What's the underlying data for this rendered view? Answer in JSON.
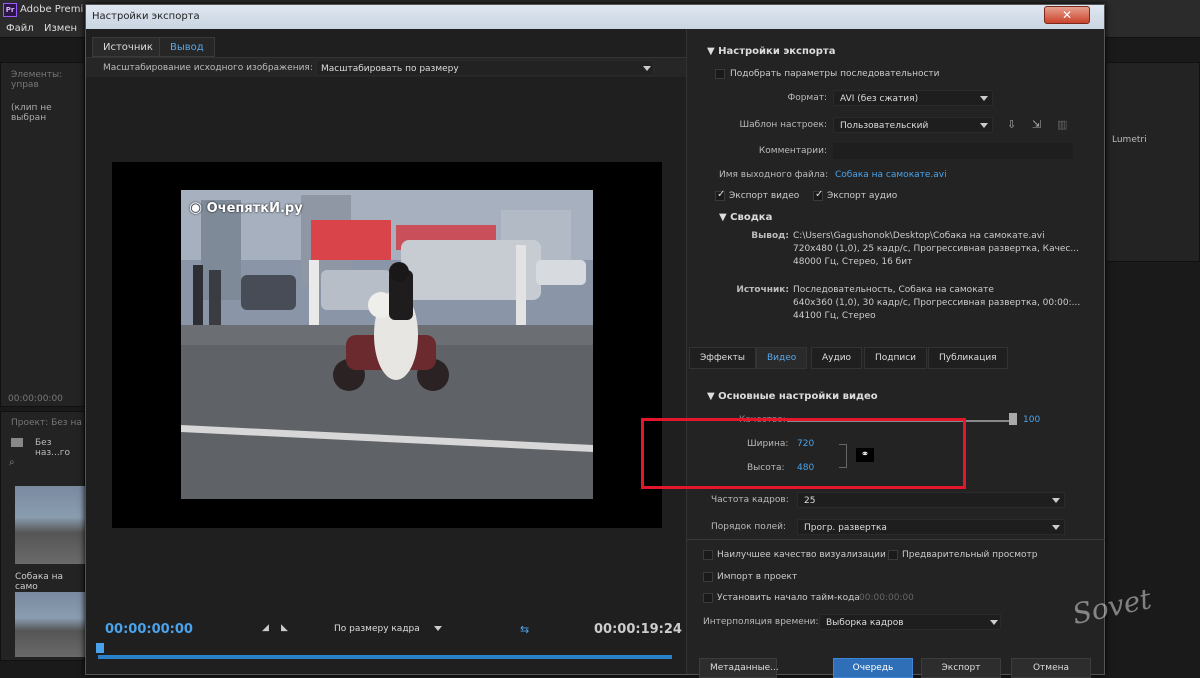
{
  "app": {
    "title": "Adobe Premi",
    "menu": [
      "Файл",
      "Измен"
    ]
  },
  "bg": {
    "panel_label_1": "Элементы: управ",
    "no_clip": "(клип не выбран",
    "timecode": "00:00:00:00",
    "project": "Проект: Без на",
    "folder": "Без наз...го",
    "clip_name": "Собака на само",
    "lumetri": "Lumetri"
  },
  "dialog": {
    "title": "Настройки экспорта",
    "close_label": "✕",
    "tabs": [
      "Источник",
      "Вывод"
    ],
    "scale_label": "Масштабирование исходного изображения:",
    "scale_value": "Масштабировать по размеру",
    "watermark": "ОчепяткИ.ру",
    "tc_start": "00:00:00:00",
    "tc_end": "00:00:19:24",
    "fit_value": "По размеру кадра"
  },
  "export": {
    "section": "Настройки экспорта",
    "match_seq": "Подобрать параметры последовательности",
    "format_label": "Формат:",
    "format_value": "AVI (без сжатия)",
    "preset_label": "Шаблон настроек:",
    "preset_value": "Пользовательский",
    "comments_label": "Комментарии:",
    "output_label": "Имя выходного файла:",
    "output_value": "Собака на самокате.avi",
    "export_video": "Экспорт видео",
    "export_audio": "Экспорт аудио",
    "summary": "Сводка",
    "out_label": "Вывод:",
    "out_lines": [
      "C:\\Users\\Gagushonok\\Desktop\\Собака на самокате.avi",
      "720x480 (1,0), 25 кадр/с, Прогрессивная развертка, Качес...",
      "48000 Гц, Стерео, 16 бит"
    ],
    "src_label": "Источник:",
    "src_lines": [
      "Последовательность, Собака на самокате",
      "640x360 (1,0), 30 кадр/с, Прогрессивная развертка, 00:00:...",
      "44100 Гц, Стерео"
    ]
  },
  "tabs2": [
    "Эффекты",
    "Видео",
    "Аудио",
    "Подписи",
    "Публикация"
  ],
  "video": {
    "section": "Основные настройки видео",
    "quality_label": "Качество:",
    "quality_value": "100",
    "quality": 1.0,
    "width_label": "Ширина:",
    "width_value": "720",
    "height_label": "Высота:",
    "height_value": "480",
    "fps_label": "Частота кадров:",
    "fps_value": "25",
    "field_label": "Порядок полей:",
    "field_value": "Прогр. развертка"
  },
  "bottom": {
    "best_quality": "Наилучшее качество визуализации",
    "preview": "Предварительный просмотр",
    "import": "Импорт в проект",
    "set_tc": "Установить начало тайм-кода",
    "tc_value": "00:00:00:00",
    "interp_label": "Интерполяция времени:",
    "interp_value": "Выборка кадров",
    "metadata": "Метаданные...",
    "queue": "Очередь",
    "export": "Экспорт",
    "cancel": "Отмена"
  },
  "accent": "#4aa3ea",
  "highlight": "#e3162b"
}
